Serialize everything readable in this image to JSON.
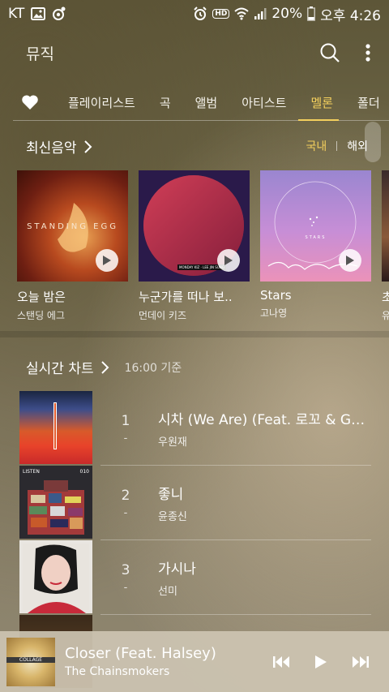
{
  "status_bar": {
    "carrier": "KT",
    "battery": "20%",
    "time": "오후 4:26",
    "hd_label": "HD"
  },
  "header": {
    "title": "뮤직"
  },
  "tabs": [
    {
      "label": "플레이리스트"
    },
    {
      "label": "곡"
    },
    {
      "label": "앨범"
    },
    {
      "label": "아티스트"
    },
    {
      "label": "멜론"
    },
    {
      "label": "폴더"
    }
  ],
  "new_music": {
    "title": "최신음악",
    "region_domestic": "국내",
    "region_foreign": "해외",
    "albums": [
      {
        "title": "오늘 밤은",
        "artist": "스탠딩 에그",
        "art_text": "STANDING EGG"
      },
      {
        "title": "누군가를 떠나 보..",
        "artist": "먼데이 키즈",
        "art_text": "MONDAY KIZ · LEE JIN SUNG"
      },
      {
        "title": "Stars",
        "artist": "고나영",
        "art_text": "STARS"
      },
      {
        "title": "초",
        "artist": "유"
      }
    ]
  },
  "realtime_chart": {
    "title": "실시간 차트",
    "time": "16:00 기준",
    "rows": [
      {
        "rank": "1",
        "change": "-",
        "title": "시차 (We Are) (Feat. 로꼬 & GRA..",
        "artist": "우원재"
      },
      {
        "rank": "2",
        "change": "-",
        "title": "좋니",
        "artist": "윤종신",
        "art_text": "LISTEN",
        "art_num": "010"
      },
      {
        "rank": "3",
        "change": "-",
        "title": "가시나",
        "artist": "선미"
      }
    ]
  },
  "mini_player": {
    "title": "Closer (Feat. Halsey)",
    "artist": "The Chainsmokers",
    "art_text": "COLLAGE"
  },
  "colors": {
    "accent": "#f3cf5d",
    "player_bg": "#cdc4b2"
  }
}
